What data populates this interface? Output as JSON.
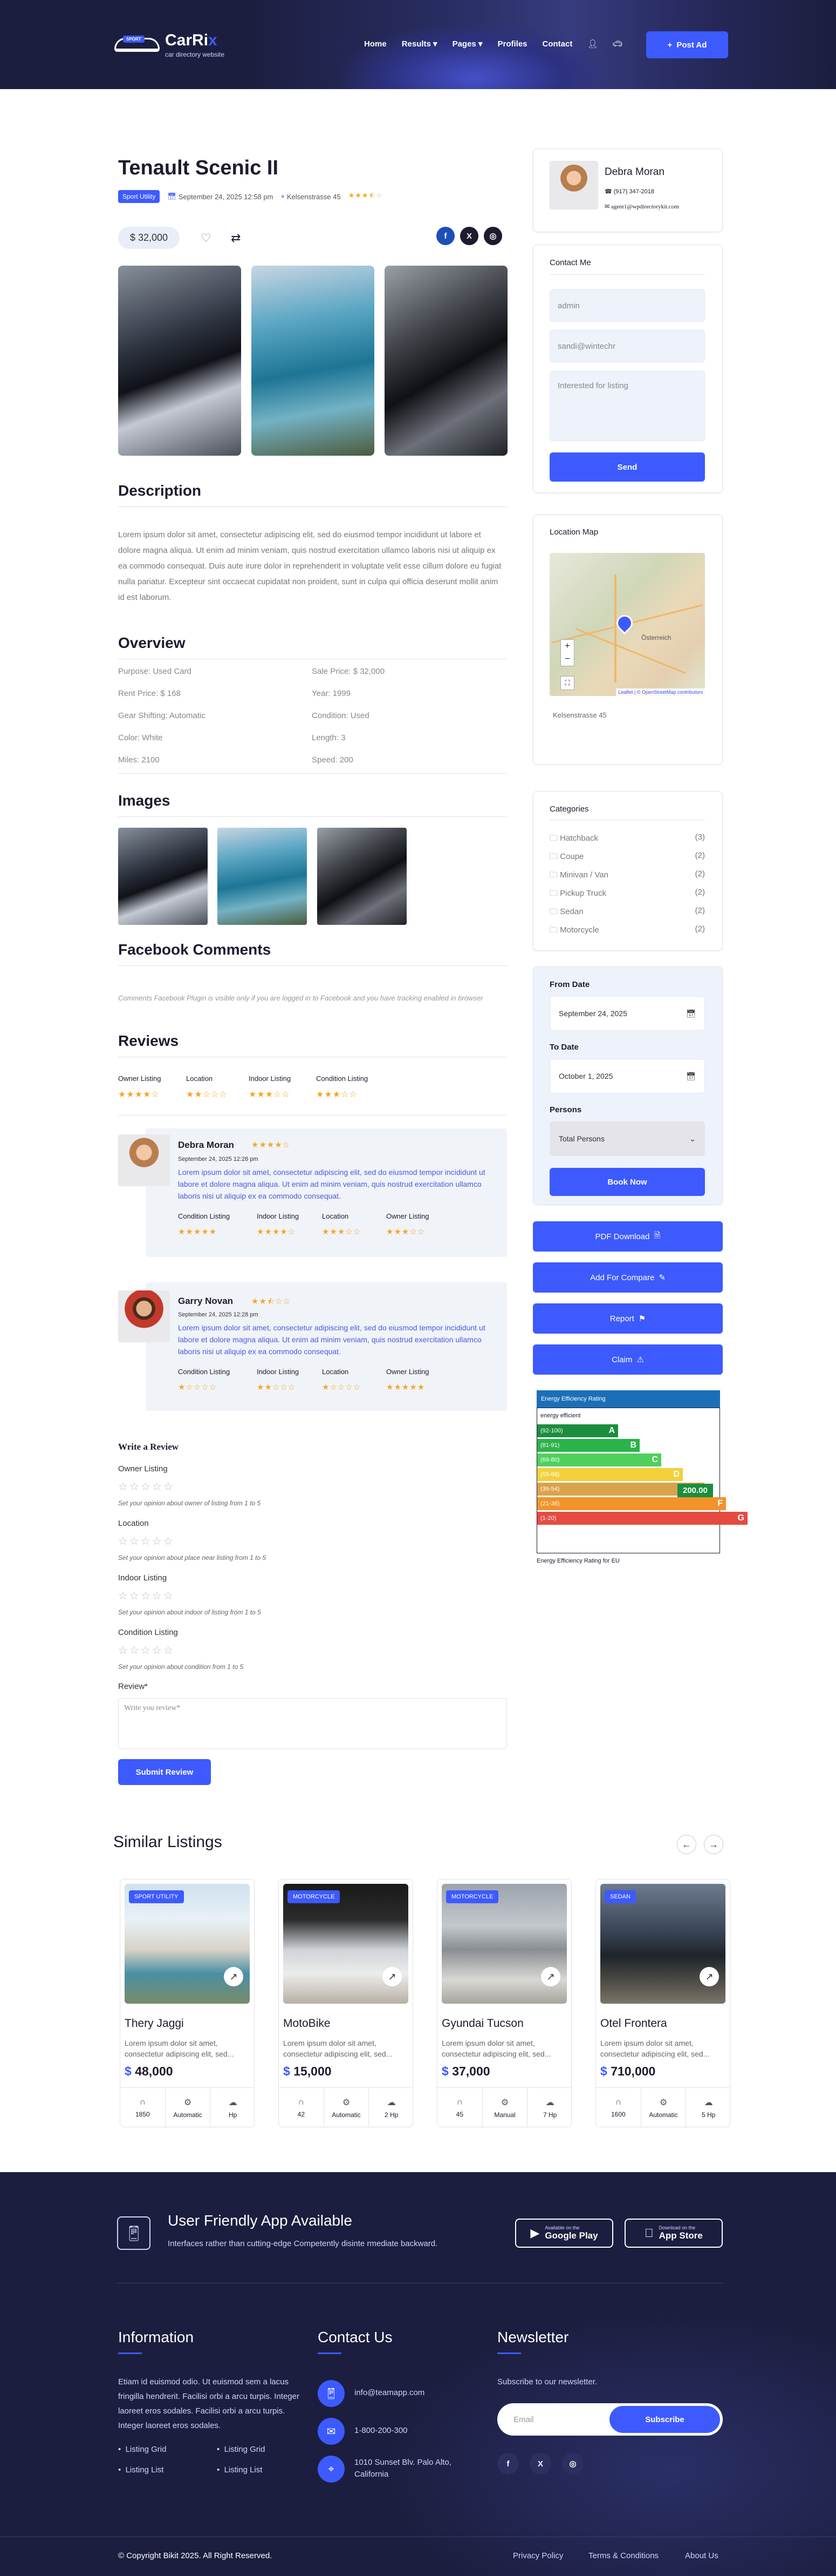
{
  "header": {
    "logo_title_a": "CarRi",
    "logo_title_b": "x",
    "logo_sub": "car directory website",
    "logo_badge": "SPORT",
    "nav": [
      "Home",
      "Results ▾",
      "Pages ▾",
      "Profiles",
      "Contact"
    ],
    "post_ad": "Post Ad"
  },
  "listing": {
    "title": "Tenault Scenic II",
    "tag": "Sport Utility",
    "date": "September 24, 2025 12:58 pm",
    "location": "Kelsenstrasse 45",
    "stars_full": "★★★",
    "stars_half": "⯪",
    "stars_empty": "☆",
    "price": "$ 32,000"
  },
  "description": {
    "heading": "Description",
    "text": "Lorem ipsum dolor sit amet, consectetur adipiscing elit, sed do eiusmod tempor incididunt ut labore et dolore magna aliqua. Ut enim ad minim veniam, quis nostrud exercitation ullamco laboris nisi ut aliquip ex ea commodo consequat. Duis aute irure dolor in reprehenderit in voluptate velit esse cillum dolore eu fugiat nulla pariatur. Excepteur sint occaecat cupidatat non proident, sunt in culpa qui officia deserunt mollit anim id est laborum."
  },
  "overview": {
    "heading": "Overview",
    "left": [
      "Purpose: Used Card",
      "Rent Price: $ 168",
      "Gear Shifting: Automatic",
      "Color: White",
      "Miles: 2100"
    ],
    "right": [
      "Sale Price: $ 32,000",
      "Year: 1999",
      "Condition: Used",
      "Length: 3",
      "Speed: 200"
    ]
  },
  "images": {
    "heading": "Images"
  },
  "facebook": {
    "heading": "Facebook Comments",
    "note": "Comments Facebook Plugin is visible only if you are logged in to Facebook and you have tracking enabled in browser"
  },
  "reviews": {
    "heading": "Reviews",
    "cats": [
      "Owner Listing",
      "Location",
      "Indoor Listing",
      "Condition Listing"
    ],
    "summary": [
      "★★★★☆",
      "★★☆☆☆",
      "★★★☆☆",
      "★★★☆☆"
    ],
    "items": [
      {
        "name": "Debra Moran",
        "stars": "★★★★☆",
        "date": "September 24, 2025 12:28 pm",
        "text": "Lorem ipsum dolor sit amet, consectetur adipiscing elit, sed do eiusmod tempor incididunt ut labore et dolore magna aliqua. Ut enim ad minim veniam, quis nostrud exercitation ullamco laboris nisi ut aliquip ex ea commodo consequat.",
        "cats": [
          "Condition Listing",
          "Indoor Listing",
          "Location",
          "Owner Listing"
        ],
        "scores": [
          "★★★★★",
          "★★★★☆",
          "★★★☆☆",
          "★★★☆☆"
        ]
      },
      {
        "name": "Garry Novan",
        "stars": "★★⯪☆☆",
        "date": "September 24, 2025 12:28 pm",
        "text": "Lorem ipsum dolor sit amet, consectetur adipiscing elit, sed do eiusmod tempor incididunt ut labore et dolore magna aliqua. Ut enim ad minim veniam, quis nostrud exercitation ullamco laboris nisi ut aliquip ex ea commodo consequat.",
        "cats": [
          "Condition Listing",
          "Indoor Listing",
          "Location",
          "Owner Listing"
        ],
        "scores": [
          "★☆☆☆☆",
          "★★☆☆☆",
          "★☆☆☆☆",
          "★★★★★"
        ]
      }
    ]
  },
  "write_review": {
    "title": "Write a Review",
    "fields": [
      {
        "label": "Owner Listing",
        "hint": "Set your opinion about owner of listing from 1 to 5"
      },
      {
        "label": "Location",
        "hint": "Set your opinion about place near listing from 1 to 5"
      },
      {
        "label": "Indoor Listing",
        "hint": "Set your opinion about indoor of listing from 1 to 5"
      },
      {
        "label": "Condition Listing",
        "hint": "Set your opinion about condition from 1 to 5"
      }
    ],
    "empty_stars": "☆☆☆☆☆",
    "review_label": "Review*",
    "review_placeholder": "Write you review*",
    "submit": "Submit Review"
  },
  "agent": {
    "name": "Debra Moran",
    "phone": "(917) 347-2018",
    "email": "agent1@wpdirectorykit.com"
  },
  "contact": {
    "heading": "Contact Me",
    "name_value": "admin",
    "email_value": "sandi@wintechr",
    "msg_placeholder": "Interested for listing",
    "send": "Send"
  },
  "map": {
    "heading": "Location Map",
    "address": "Kelsenstrasse 45",
    "attrib": "Leaflet | © OpenStreetMap contributors",
    "city": "Österreich"
  },
  "categories": {
    "heading": "Categories",
    "items": [
      {
        "name": "Hatchback",
        "count": "(3)"
      },
      {
        "name": "Coupe",
        "count": "(2)"
      },
      {
        "name": "Minivan / Van",
        "count": "(2)"
      },
      {
        "name": "Pickup Truck",
        "count": "(2)"
      },
      {
        "name": "Sedan",
        "count": "(2)"
      },
      {
        "name": "Motorcycle",
        "count": "(2)"
      }
    ]
  },
  "booking": {
    "from_label": "From Date",
    "from_value": "September 24, 2025",
    "to_label": "To Date",
    "to_value": "October 1, 2025",
    "persons_label": "Persons",
    "persons_value": "Total Persons",
    "book": "Book Now"
  },
  "actions": [
    "PDF Download",
    "Add For Compare",
    "Report",
    "Claim"
  ],
  "energy": {
    "header": "Energy Efficiency Rating",
    "efficient": "energy efficient",
    "footer": "Energy Efficiency Rating for EU",
    "value": "200.00",
    "bands": [
      {
        "range": "(92-100)",
        "letter": "A",
        "color": "#1b8e3e"
      },
      {
        "range": "(81-91)",
        "letter": "B",
        "color": "#2bb34a"
      },
      {
        "range": "(69-80)",
        "letter": "C",
        "color": "#4fd05c"
      },
      {
        "range": "(55-68)",
        "letter": "D",
        "color": "#f2d13b"
      },
      {
        "range": "(39-54)",
        "letter": "E",
        "color": "#d9a34a"
      },
      {
        "range": "(21-38)",
        "letter": "F",
        "color": "#f1932a"
      },
      {
        "range": "(1-20)",
        "letter": "G",
        "color": "#e54b40"
      }
    ]
  },
  "similar": {
    "heading": "Similar Listings",
    "items": [
      {
        "badge": "SPORT UTILITY",
        "name": "Thery Jaggi",
        "desc": "Lorem ipsum dolor sit amet, consectetur adipiscing elit, sed...",
        "price": "48,000",
        "specs": [
          "1850",
          "Automatic",
          "Hp"
        ]
      },
      {
        "badge": "MOTORCYCLE",
        "name": "MotoBike",
        "desc": "Lorem ipsum dolor sit amet, consectetur adipiscing elit, sed...",
        "price": "15,000",
        "specs": [
          "42",
          "Automatic",
          "2 Hp"
        ]
      },
      {
        "badge": "MOTORCYCLE",
        "name": "Gyundai Tucson",
        "desc": "Lorem ipsum dolor sit amet, consectetur adipiscing elit, sed...",
        "price": "37,000",
        "specs": [
          "45",
          "Manual",
          "7 Hp"
        ]
      },
      {
        "badge": "SEDAN",
        "name": "Otel Frontera",
        "desc": "Lorem ipsum dolor sit amet, consectetur adipiscing elit, sed...",
        "price": "710,000",
        "specs": [
          "1600",
          "Automatic",
          "5 Hp"
        ]
      }
    ]
  },
  "footer": {
    "app_title": "User Friendly App Available",
    "app_sub": "Interfaces rather than cutting-edge Competently disinte rmediate backward.",
    "gplay_small": "Available on the",
    "gplay": "Google Play",
    "apple_small": "Download on the",
    "apple": "App Store",
    "info_heading": "Information",
    "info_text": "Etiam id euismod odio. Ut euismod sem a lacus fringilla hendrerit. Facilisi orbi a arcu turpis. Integer laoreet eros sodales. Facilisi orbi a arcu turpis. Integer laoreet eros sodales.",
    "links": [
      "Listing Grid",
      "Listing Grid",
      "Listing List",
      "Listing List"
    ],
    "contact_heading": "Contact Us",
    "email": "info@teamapp.com",
    "phone": "1-800-200-300",
    "address": "1010 Sunset Blv. Palo Alto, California",
    "news_heading": "Newsletter",
    "news_text": "Subscribe to our newsletter.",
    "email_placeholder": "Email",
    "subscribe": "Subscribe",
    "copyright": "© Copyright Bikit 2025. All Right Reserved.",
    "bottom_links": [
      "Privacy Policy",
      "Terms & Conditions",
      "About Us"
    ]
  }
}
